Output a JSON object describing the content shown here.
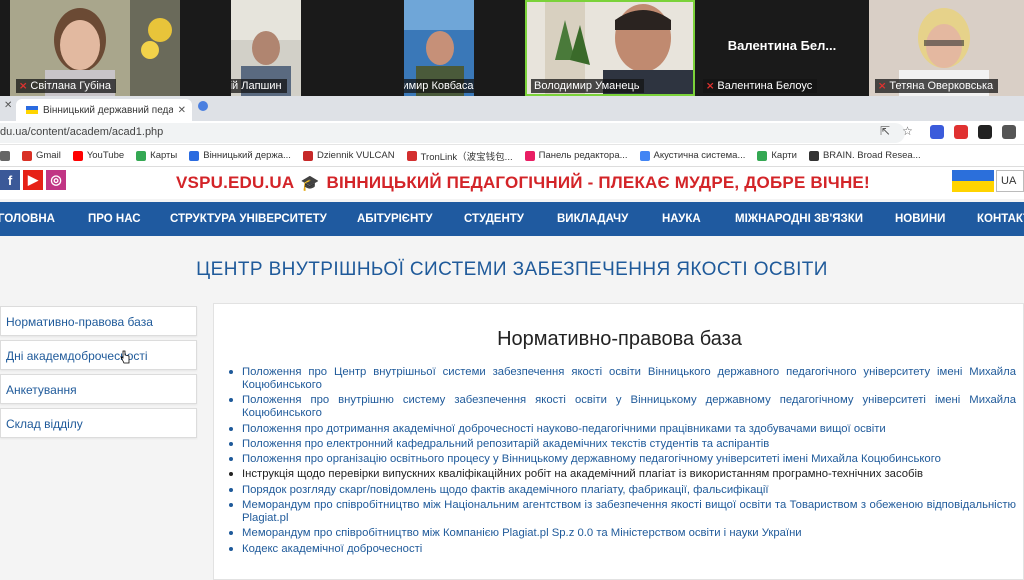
{
  "video": {
    "participants": [
      {
        "name": "Світлана Губіна",
        "muted": true,
        "active": false
      },
      {
        "name": "Сергій Лапшин",
        "muted": true,
        "active": false
      },
      {
        "name": "Володимир Ковбаса",
        "muted": true,
        "active": false
      },
      {
        "name": "Володимир Уманець",
        "muted": false,
        "active": true
      },
      {
        "name": "Валентина Белоус",
        "muted": true,
        "active": false,
        "big_label": "Валентина Бел..."
      },
      {
        "name": "Тетяна Оверковська",
        "muted": true,
        "active": false
      }
    ]
  },
  "browser": {
    "tab_title": "Вінницький державний педаго",
    "url": "du.ua/content/academ/acad1.php",
    "bookmarks": [
      {
        "label": "",
        "icon": "apps-icon",
        "color": "#666"
      },
      {
        "label": "Gmail",
        "icon": "gmail-icon",
        "color": "#d93025"
      },
      {
        "label": "YouTube",
        "icon": "youtube-icon",
        "color": "#ff0000"
      },
      {
        "label": "Карты",
        "icon": "maps-icon",
        "color": "#34a853"
      },
      {
        "label": "Вінницький держа...",
        "icon": "vspu-icon",
        "color": "#2a6be0"
      },
      {
        "label": "Dziennik VULCAN",
        "icon": "vulcan-icon",
        "color": "#c62828"
      },
      {
        "label": "TronLink（波宝钱包...",
        "icon": "tronlink-icon",
        "color": "#d32f2f"
      },
      {
        "label": "Панель редактора...",
        "icon": "editor-icon",
        "color": "#e91e63"
      },
      {
        "label": "Акустична система...",
        "icon": "google-icon",
        "color": "#4285f4"
      },
      {
        "label": "Карти",
        "icon": "maps-icon",
        "color": "#34a853"
      },
      {
        "label": "BRAIN. Broad Resea...",
        "icon": "brain-icon",
        "color": "#333"
      }
    ]
  },
  "site": {
    "tagline_left": "VSPU.EDU.UA",
    "tagline_right": "ВІННИЦЬКИЙ ПЕДАГОГІЧНИЙ - ПЛЕКАЄ МУДРЕ, ДОБРЕ ВІЧНЕ!",
    "lang": "UA",
    "nav": [
      "ГОЛОВНА",
      "ПРО НАС",
      "СТРУКТУРА УНІВЕРСИТЕТУ",
      "АБІТУРІЄНТУ",
      "СТУДЕНТУ",
      "ВИКЛАДАЧУ",
      "НАУКА",
      "МІЖНАРОДНІ ЗВ'ЯЗКИ",
      "НОВИНИ",
      "КОНТАКТИ"
    ],
    "centre_title": "ЦЕНТР ВНУТРІШНЬОЇ СИСТЕМИ ЗАБЕЗПЕЧЕННЯ ЯКОСТІ ОСВІТИ",
    "sidebar": [
      "Нормативно-правова база",
      "Дні академдоброчесності",
      "Анкетування",
      "Склад відділу"
    ],
    "content_title": "Нормативно-правова база",
    "documents": [
      {
        "text": "Положення про Центр внутрішньої системи забезпечення якості освіти Вінницького державного педагогічного університету імені Михайла Коцюбинського",
        "link": true
      },
      {
        "text": "Положення про внутрішню систему забезпечення якості освіти у Вінницькому державному педагогічному університеті імені Михайла Коцюбинського",
        "link": true
      },
      {
        "text": "Положення про дотримання академічної доброчесності науково-педагогічними працівниками та здобувачами вищої освіти",
        "link": true
      },
      {
        "text": "Положення про електронний кафедральний репозитарій академічних текстів студентів та аспірантів",
        "link": true
      },
      {
        "text": "Положення про організацію освітнього процесу у Вінницькому державному педагогічному університеті імені Михайла Коцюбинського",
        "link": true
      },
      {
        "text": "Інструкція щодо перевірки випускних кваліфікаційних робіт на академічний плагіат із використанням програмно-технічних засобів",
        "link": false
      },
      {
        "text": "Порядок розгляду скарг/повідомлень щодо фактів академічного плагіату, фабрикації, фальсифікації",
        "link": true
      },
      {
        "text": "Меморандум про співробітництво між Національним агентством із забезпечення якості вищої освіти та Товариством з обеженою відповідальністю Plagiat.pl",
        "link": true
      },
      {
        "text": "Меморандум про співробітництво між Компанією Plagiat.pl Sp.z 0.0 та Міністерством освіти і науки України",
        "link": true
      },
      {
        "text": "Кодекс академічної доброчесності",
        "link": true
      }
    ]
  },
  "colors": {
    "nav_bg": "#1f5aa0",
    "brand_red": "#d32428",
    "link_blue": "#1f5a9a"
  }
}
